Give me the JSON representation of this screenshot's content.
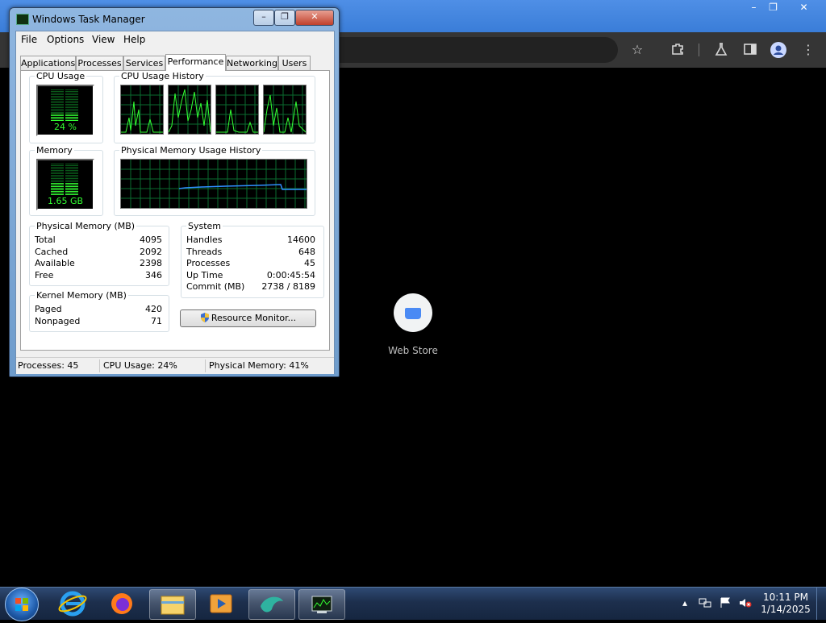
{
  "browser": {
    "window_controls": [
      "–",
      "❐",
      "✕"
    ],
    "toolbar_icons": [
      "star-icon",
      "extensions-icon",
      "lab-icon",
      "side-panel-icon",
      "profile-icon",
      "menu-icon"
    ],
    "shortcut": {
      "label": "Web Store"
    }
  },
  "task_manager": {
    "title": "Windows Task Manager",
    "window_controls": [
      "–",
      "❐",
      "✕"
    ],
    "menu": [
      "File",
      "Options",
      "View",
      "Help"
    ],
    "tabs": [
      "Applications",
      "Processes",
      "Services",
      "Performance",
      "Networking",
      "Users"
    ],
    "active_tab": "Performance",
    "cpu_usage": {
      "label": "CPU Usage",
      "value": "24 %",
      "percent": 24
    },
    "cpu_history": {
      "label": "CPU Usage History",
      "cores": 4
    },
    "memory": {
      "label": "Memory",
      "value": "1.65 GB",
      "percent": 41
    },
    "memory_history": {
      "label": "Physical Memory Usage History"
    },
    "physical_memory": {
      "title": "Physical Memory (MB)",
      "rows": [
        {
          "label": "Total",
          "value": "4095"
        },
        {
          "label": "Cached",
          "value": "2092"
        },
        {
          "label": "Available",
          "value": "2398"
        },
        {
          "label": "Free",
          "value": "346"
        }
      ]
    },
    "kernel_memory": {
      "title": "Kernel Memory (MB)",
      "rows": [
        {
          "label": "Paged",
          "value": "420"
        },
        {
          "label": "Nonpaged",
          "value": "71"
        }
      ]
    },
    "system": {
      "title": "System",
      "rows": [
        {
          "label": "Handles",
          "value": "14600"
        },
        {
          "label": "Threads",
          "value": "648"
        },
        {
          "label": "Processes",
          "value": "45"
        },
        {
          "label": "Up Time",
          "value": "0:00:45:54"
        },
        {
          "label": "Commit (MB)",
          "value": "2738 / 8189"
        }
      ]
    },
    "resource_monitor_button": "Resource Monitor...",
    "status": {
      "processes": "Processes: 45",
      "cpu": "CPU Usage: 24%",
      "memory": "Physical Memory: 41%"
    }
  },
  "taskbar": {
    "pinned": [
      "internet-explorer-icon",
      "firefox-icon",
      "explorer-icon",
      "media-player-icon",
      "app-icon",
      "task-manager-icon"
    ],
    "tray_icons": [
      "show-hidden-icon",
      "network-icon",
      "action-center-icon",
      "volume-muted-icon"
    ],
    "time": "10:11 PM",
    "date": "1/14/2025"
  }
}
